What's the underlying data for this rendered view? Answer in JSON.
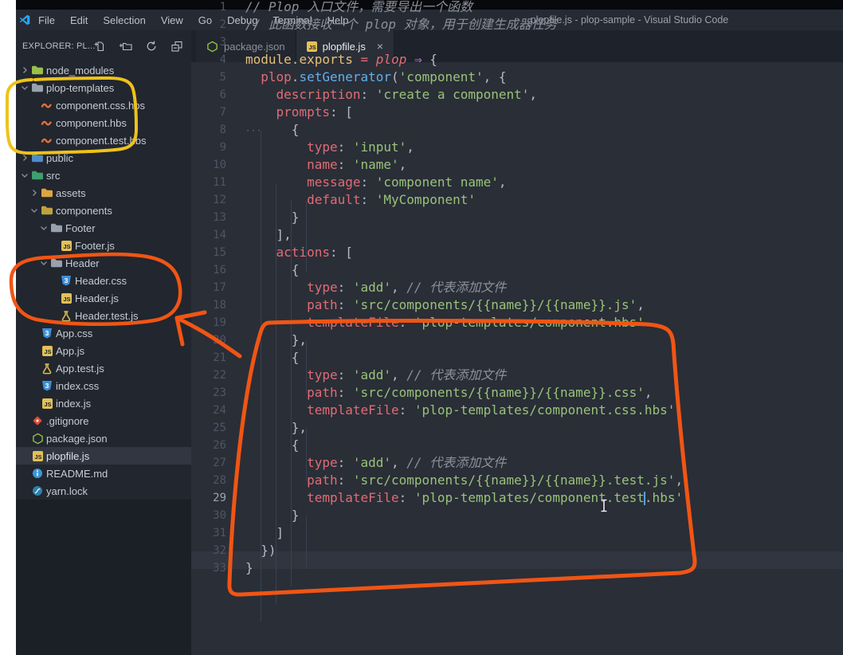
{
  "window": {
    "title": "plopfile.js - plop-sample - Visual Studio Code",
    "logo_icon": "vscode-logo",
    "menus": [
      "File",
      "Edit",
      "Selection",
      "View",
      "Go",
      "Debug",
      "Terminal",
      "Help"
    ]
  },
  "explorer": {
    "header": "EXPLORER: PL...",
    "actions": [
      "new-file",
      "new-folder",
      "refresh",
      "collapse-all"
    ],
    "tree": [
      {
        "label": "node_modules",
        "icon": "folder-node",
        "chevron": "right",
        "depth": 0
      },
      {
        "label": "plop-templates",
        "icon": "folder-gray",
        "chevron": "down",
        "depth": 0
      },
      {
        "label": "component.css.hbs",
        "icon": "hbs",
        "depth": 1
      },
      {
        "label": "component.hbs",
        "icon": "hbs",
        "depth": 1
      },
      {
        "label": "component.test.hbs",
        "icon": "hbs",
        "depth": 1
      },
      {
        "label": "public",
        "icon": "folder-blue",
        "chevron": "right",
        "depth": 0
      },
      {
        "label": "src",
        "icon": "folder-src",
        "chevron": "down",
        "depth": 0
      },
      {
        "label": "assets",
        "icon": "folder-yellow",
        "chevron": "right",
        "depth": 1
      },
      {
        "label": "components",
        "icon": "folder-components",
        "chevron": "down",
        "depth": 1
      },
      {
        "label": "Footer",
        "icon": "folder-gray",
        "chevron": "down",
        "depth": 2
      },
      {
        "label": "Footer.js",
        "icon": "js",
        "depth": 3
      },
      {
        "label": "Header",
        "icon": "folder-gray",
        "chevron": "down",
        "depth": 2
      },
      {
        "label": "Header.css",
        "icon": "css",
        "depth": 3
      },
      {
        "label": "Header.js",
        "icon": "js",
        "depth": 3
      },
      {
        "label": "Header.test.js",
        "icon": "flask",
        "depth": 3
      },
      {
        "label": "App.css",
        "icon": "css",
        "depth": 1
      },
      {
        "label": "App.js",
        "icon": "js",
        "depth": 1
      },
      {
        "label": "App.test.js",
        "icon": "flask",
        "depth": 1
      },
      {
        "label": "index.css",
        "icon": "css",
        "depth": 1
      },
      {
        "label": "index.js",
        "icon": "js",
        "depth": 1
      },
      {
        "label": ".gitignore",
        "icon": "git",
        "depth": 0
      },
      {
        "label": "package.json",
        "icon": "npm",
        "depth": 0
      },
      {
        "label": "plopfile.js",
        "icon": "js",
        "depth": 0,
        "selected": true
      },
      {
        "label": "README.md",
        "icon": "info",
        "depth": 0
      },
      {
        "label": "yarn.lock",
        "icon": "yarn",
        "depth": 0
      }
    ]
  },
  "tabs": [
    {
      "label": "package.json",
      "icon": "npm",
      "active": false
    },
    {
      "label": "plopfile.js",
      "icon": "js",
      "active": true,
      "close": "×"
    }
  ],
  "editor": {
    "current_line": 29,
    "lines": [
      {
        "n": 1,
        "tokens": [
          [
            "c",
            "// Plop 入口文件，需要导出一个函数"
          ]
        ]
      },
      {
        "n": 2,
        "tokens": [
          [
            "c",
            "// 此函数接收一个 plop 对象，用于创建生成器任务"
          ]
        ]
      },
      {
        "n": 3,
        "tokens": []
      },
      {
        "n": 4,
        "tokens": [
          [
            "m",
            "module"
          ],
          [
            "p",
            "."
          ],
          [
            "m",
            "exports"
          ],
          [
            "p",
            " "
          ],
          [
            "o",
            "="
          ],
          [
            "p",
            " "
          ],
          [
            "pi",
            "plop"
          ],
          [
            "p",
            " "
          ],
          [
            "a",
            "⇒"
          ],
          [
            "p",
            " {"
          ]
        ]
      },
      {
        "n": 5,
        "tokens": [
          [
            "p",
            "  "
          ],
          [
            "v",
            "plop"
          ],
          [
            "p",
            "."
          ],
          [
            "f",
            "setGenerator"
          ],
          [
            "p",
            "("
          ],
          [
            "s",
            "'component'"
          ],
          [
            "p",
            ", {"
          ]
        ]
      },
      {
        "n": 6,
        "tokens": [
          [
            "p",
            "    "
          ],
          [
            "k",
            "description"
          ],
          [
            "p",
            ": "
          ],
          [
            "s",
            "'create a component'"
          ],
          [
            "p",
            ","
          ]
        ]
      },
      {
        "n": 7,
        "tokens": [
          [
            "p",
            "    "
          ],
          [
            "k",
            "prompts"
          ],
          [
            "p",
            ": ["
          ]
        ]
      },
      {
        "n": 8,
        "tokens": [
          [
            "p",
            "      {"
          ]
        ]
      },
      {
        "n": 9,
        "tokens": [
          [
            "p",
            "        "
          ],
          [
            "k",
            "type"
          ],
          [
            "p",
            ": "
          ],
          [
            "s",
            "'input'"
          ],
          [
            "p",
            ","
          ]
        ]
      },
      {
        "n": 10,
        "tokens": [
          [
            "p",
            "        "
          ],
          [
            "k",
            "name"
          ],
          [
            "p",
            ": "
          ],
          [
            "s",
            "'name'"
          ],
          [
            "p",
            ","
          ]
        ]
      },
      {
        "n": 11,
        "tokens": [
          [
            "p",
            "        "
          ],
          [
            "k",
            "message"
          ],
          [
            "p",
            ": "
          ],
          [
            "s",
            "'component name'"
          ],
          [
            "p",
            ","
          ]
        ]
      },
      {
        "n": 12,
        "tokens": [
          [
            "p",
            "        "
          ],
          [
            "k",
            "default"
          ],
          [
            "p",
            ": "
          ],
          [
            "s",
            "'MyComponent'"
          ]
        ]
      },
      {
        "n": 13,
        "tokens": [
          [
            "p",
            "      }"
          ]
        ]
      },
      {
        "n": 14,
        "tokens": [
          [
            "p",
            "    ],"
          ]
        ]
      },
      {
        "n": 15,
        "tokens": [
          [
            "p",
            "    "
          ],
          [
            "k",
            "actions"
          ],
          [
            "p",
            ": ["
          ]
        ]
      },
      {
        "n": 16,
        "tokens": [
          [
            "p",
            "      {"
          ]
        ]
      },
      {
        "n": 17,
        "tokens": [
          [
            "p",
            "        "
          ],
          [
            "k",
            "type"
          ],
          [
            "p",
            ": "
          ],
          [
            "s",
            "'add'"
          ],
          [
            "p",
            ", "
          ],
          [
            "c",
            "// 代表添加文件"
          ]
        ]
      },
      {
        "n": 18,
        "tokens": [
          [
            "p",
            "        "
          ],
          [
            "k",
            "path"
          ],
          [
            "p",
            ": "
          ],
          [
            "s",
            "'src/components/{{name}}/{{name}}.js'"
          ],
          [
            "p",
            ","
          ]
        ]
      },
      {
        "n": 19,
        "tokens": [
          [
            "p",
            "        "
          ],
          [
            "k",
            "templateFile"
          ],
          [
            "p",
            ": "
          ],
          [
            "s",
            "'plop-templates/component.hbs'"
          ]
        ]
      },
      {
        "n": 20,
        "tokens": [
          [
            "p",
            "      },"
          ]
        ]
      },
      {
        "n": 21,
        "tokens": [
          [
            "p",
            "      {"
          ]
        ]
      },
      {
        "n": 22,
        "tokens": [
          [
            "p",
            "        "
          ],
          [
            "k",
            "type"
          ],
          [
            "p",
            ": "
          ],
          [
            "s",
            "'add'"
          ],
          [
            "p",
            ", "
          ],
          [
            "c",
            "// 代表添加文件"
          ]
        ]
      },
      {
        "n": 23,
        "tokens": [
          [
            "p",
            "        "
          ],
          [
            "k",
            "path"
          ],
          [
            "p",
            ": "
          ],
          [
            "s",
            "'src/components/{{name}}/{{name}}.css'"
          ],
          [
            "p",
            ","
          ]
        ]
      },
      {
        "n": 24,
        "tokens": [
          [
            "p",
            "        "
          ],
          [
            "k",
            "templateFile"
          ],
          [
            "p",
            ": "
          ],
          [
            "s",
            "'plop-templates/component.css.hbs'"
          ]
        ]
      },
      {
        "n": 25,
        "tokens": [
          [
            "p",
            "      },"
          ]
        ]
      },
      {
        "n": 26,
        "tokens": [
          [
            "p",
            "      {"
          ]
        ]
      },
      {
        "n": 27,
        "tokens": [
          [
            "p",
            "        "
          ],
          [
            "k",
            "type"
          ],
          [
            "p",
            ": "
          ],
          [
            "s",
            "'add'"
          ],
          [
            "p",
            ", "
          ],
          [
            "c",
            "// 代表添加文件"
          ]
        ]
      },
      {
        "n": 28,
        "tokens": [
          [
            "p",
            "        "
          ],
          [
            "k",
            "path"
          ],
          [
            "p",
            ": "
          ],
          [
            "s",
            "'src/components/{{name}}/{{name}}.test.js'"
          ],
          [
            "p",
            ","
          ]
        ]
      },
      {
        "n": 29,
        "tokens": [
          [
            "p",
            "        "
          ],
          [
            "k",
            "templateFile"
          ],
          [
            "p",
            ": "
          ],
          [
            "s",
            "'plop-templates/component"
          ],
          [
            "ib",
            ""
          ],
          [
            "s",
            ".test"
          ],
          [
            "cr",
            ""
          ],
          [
            "s",
            ".hbs'"
          ]
        ]
      },
      {
        "n": 30,
        "tokens": [
          [
            "p",
            "      }"
          ]
        ]
      },
      {
        "n": 31,
        "tokens": [
          [
            "p",
            "    ]"
          ]
        ]
      },
      {
        "n": 32,
        "tokens": [
          [
            "p",
            "  })"
          ]
        ]
      },
      {
        "n": 33,
        "tokens": [
          [
            "p",
            "}"
          ]
        ]
      }
    ]
  },
  "annotations": {
    "yellow_loop_color": "#eec31a",
    "orange_color": "#f05514",
    "caret_color": "#5c9cf5",
    "items": [
      "yellow-loop-plop-templates",
      "orange-loop-header-folder",
      "orange-arrow-to-header",
      "orange-box-actions-code"
    ]
  }
}
